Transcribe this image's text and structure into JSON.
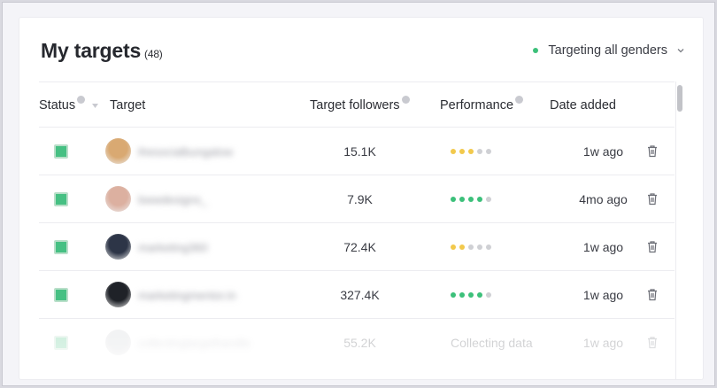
{
  "page": {
    "title": "My targets",
    "count": "(48)"
  },
  "filter": {
    "label": "Targeting all genders",
    "status_color": "#3cc07a"
  },
  "columns": {
    "status": "Status",
    "target": "Target",
    "followers": "Target followers",
    "performance": "Performance",
    "date": "Date added"
  },
  "rows": [
    {
      "handle": "thesocialbungalow",
      "followers": "15.1K",
      "performance_level": 3,
      "performance_max": 5,
      "performance_color": "#f2c94c",
      "date": "1w ago",
      "avatar_color": "#d9a972",
      "checked": true
    },
    {
      "handle": "bwwdesigns_",
      "followers": "7.9K",
      "performance_level": 4,
      "performance_max": 5,
      "performance_color": "#3cc07a",
      "date": "4mo ago",
      "avatar_color": "#dcb0a0",
      "checked": true
    },
    {
      "handle": "marketing360",
      "followers": "72.4K",
      "performance_level": 2,
      "performance_max": 5,
      "performance_color": "#f2c94c",
      "date": "1w ago",
      "avatar_color": "#2d3547",
      "checked": true
    },
    {
      "handle": "marketingmentor.in",
      "followers": "327.4K",
      "performance_level": 4,
      "performance_max": 5,
      "performance_color": "#3cc07a",
      "date": "1w ago",
      "avatar_color": "#1f2228",
      "checked": true
    },
    {
      "handle": "collectingtargethandle",
      "followers": "55.2K",
      "performance_text": "Collecting data",
      "date": "1w ago",
      "avatar_color": "#cfd0d4",
      "checked": true
    }
  ],
  "colors": {
    "checkbox_green": "#46c083",
    "dot_empty": "#cfd0d4"
  },
  "icons": {
    "filter_chevron": "chevron-down-icon",
    "sort": "sort-down-icon",
    "info": "info-icon",
    "delete": "trash-icon"
  }
}
